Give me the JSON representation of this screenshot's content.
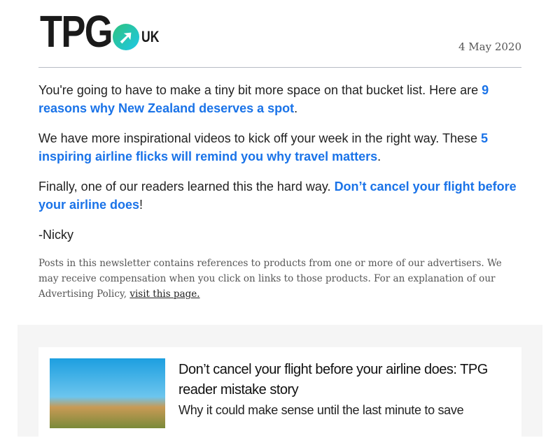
{
  "header": {
    "logo_text": "TPG",
    "logo_suffix": "UK",
    "date": "4 May 2020"
  },
  "paragraphs": [
    {
      "before": "You're going to have to make a tiny bit more space on that bucket list. Here are ",
      "link": "9 reasons why New Zealand deserves a spot",
      "after": "."
    },
    {
      "before": "We have more inspirational videos to kick off your week in the right way. These ",
      "link": "5 inspiring airline flicks will remind you why travel matters",
      "after": "."
    },
    {
      "before": "Finally, one of our readers learned this the hard way. ",
      "link": "Don’t cancel your flight before your airline does",
      "after": "!"
    }
  ],
  "signature": "-Nicky",
  "disclaimer": {
    "text": "Posts in this newsletter contains references to products from one or more of our advertisers. We may receive compensation when you click on links to those products. For an explanation of our Advertising Policy, ",
    "link": "visit this page."
  },
  "card": {
    "title": "Don’t cancel your flight before your airline does: TPG reader mistake story",
    "description": "Why it could make sense until the last minute to save"
  },
  "colors": {
    "link": "#1a73e8",
    "panel": "#f5f5f5"
  }
}
